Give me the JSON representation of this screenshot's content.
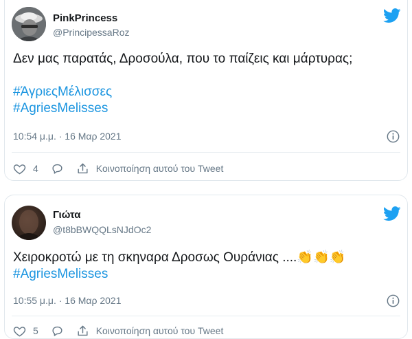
{
  "tweets": [
    {
      "name": "PinkPrincess",
      "handle": "@PrincipessaRoz",
      "text": "Δεν μας παρατάς, Δροσούλα, που το παίζεις και μάρτυρας;",
      "hashtags": [
        "#ΆγριεςΜέλισσες",
        "#AgriesMelisses"
      ],
      "timestamp": "10:54 μ.μ. · 16 Μαρ 2021",
      "like_count": "4",
      "share_label": "Κοινοποίηση αυτού του Tweet",
      "avatar_icon": "profile-photo"
    },
    {
      "name": "Γιώτα",
      "handle": "@t8bBWQQLsNJdOc2",
      "text": "Χειροκροτώ με τη σκηναρα Δροσως Ουράνιας ....👏👏👏",
      "hashtags": [
        "#AgriesMelisses"
      ],
      "timestamp": "10:55 μ.μ. · 16 Μαρ 2021",
      "like_count": "5",
      "share_label": "Κοινοποίηση αυτού του Tweet",
      "avatar_icon": "profile-photo"
    }
  ],
  "colors": {
    "twitter_blue": "#1da1f2",
    "hashtag": "#1b95e0",
    "secondary_text": "#657786",
    "border": "#e1e8ed"
  }
}
